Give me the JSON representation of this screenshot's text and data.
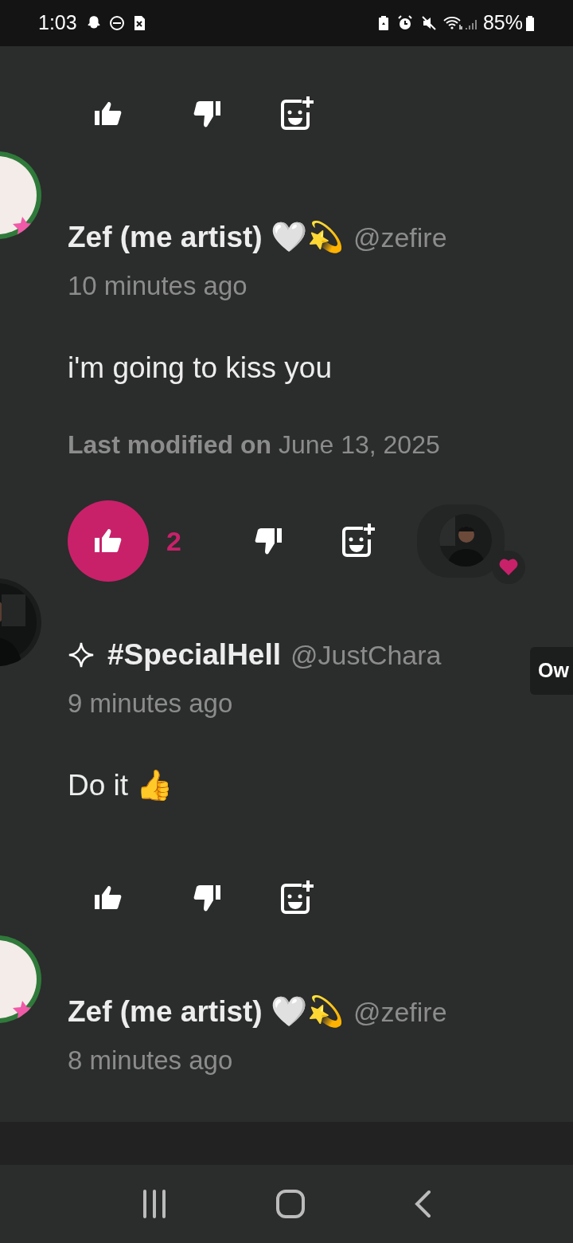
{
  "status_bar": {
    "time": "1:03",
    "battery": "85%"
  },
  "top_reactions": {
    "liked": false
  },
  "comments": [
    {
      "author": "Zef (me artist) 🤍💫",
      "handle": "@zefire",
      "time": "10 minutes ago",
      "flair": false,
      "body": "i'm going to kiss you",
      "modified": "**Last modified on** June 13, 2025",
      "reactions": {
        "liked": true,
        "count": "2",
        "reactor": true
      }
    },
    {
      "author": "#SpecialHell",
      "handle": "@JustChara",
      "time": "9 minutes ago",
      "flair": true,
      "tooltip": "Ow",
      "body": "Do it 👍",
      "reactions": {
        "liked": false,
        "reactor": false
      }
    },
    {
      "author": "Zef (me artist) 🤍💫",
      "handle": "@zefire",
      "time": "8 minutes ago",
      "flair": false
    }
  ]
}
